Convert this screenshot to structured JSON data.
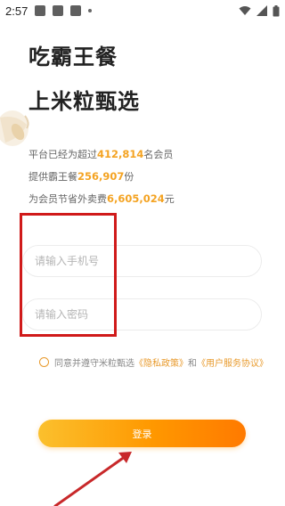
{
  "status_bar": {
    "time": "2:57"
  },
  "heading": {
    "line1": "吃霸王餐",
    "line2": "上米粒甄选"
  },
  "stats": [
    {
      "prefix": "平台已经为超过",
      "value": "412,814",
      "suffix": "名会员"
    },
    {
      "prefix": "提供霸王餐",
      "value": "256,907",
      "suffix": "份"
    },
    {
      "prefix": "为会员节省外卖费",
      "value": "6,605,024",
      "suffix": "元"
    }
  ],
  "form": {
    "phone_placeholder": "请输入手机号",
    "password_placeholder": "请输入密码"
  },
  "agreement": {
    "prefix": "同意并遵守米粒甄选",
    "privacy_link": "《隐私政策》",
    "and": "和",
    "terms_link": "《用户服务协议》"
  },
  "login_button": "登录",
  "colors": {
    "accent": "#f4a322",
    "highlight": "#d01a1a",
    "button_gradient_start": "#fbc02d",
    "button_gradient_end": "#ff7a00"
  }
}
